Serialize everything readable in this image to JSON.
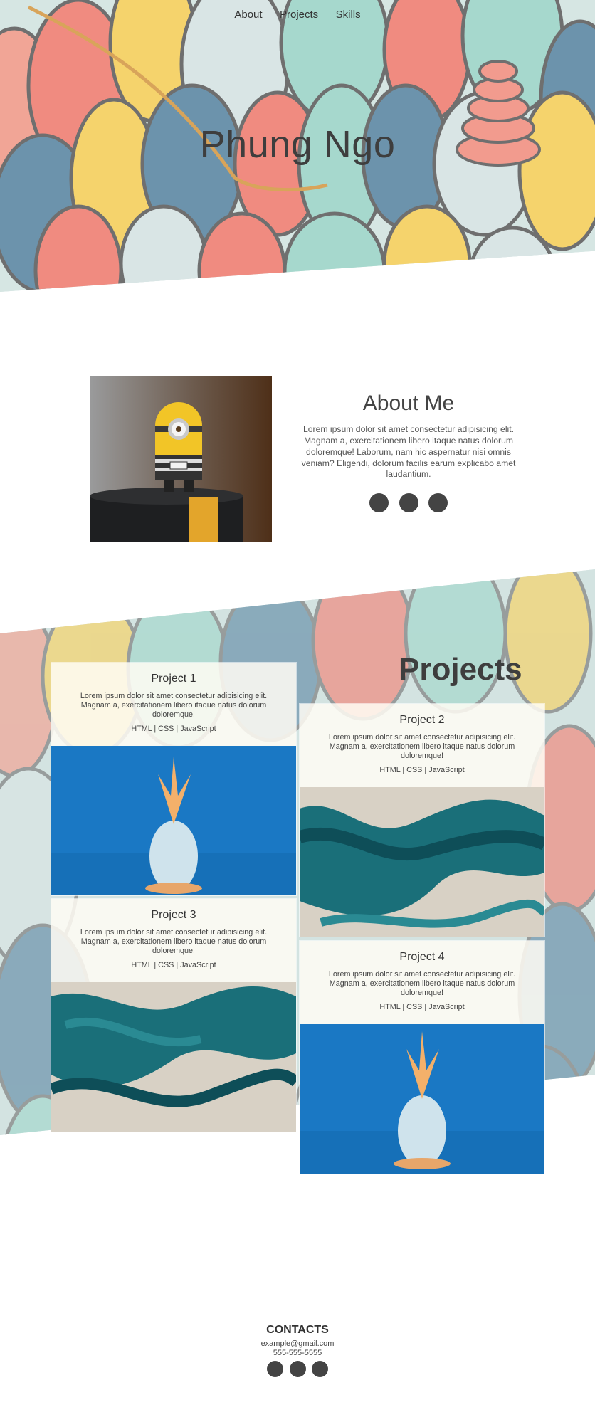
{
  "nav": {
    "items": [
      {
        "label": "About"
      },
      {
        "label": "Projects"
      },
      {
        "label": "Skills"
      }
    ]
  },
  "hero": {
    "title": "Phung Ngo",
    "background_palette": [
      "#f0877c",
      "#f5d36c",
      "#a6d8cd",
      "#6c93ac",
      "#d7e4e4"
    ]
  },
  "about": {
    "heading": "About Me",
    "text": "Lorem ipsum dolor sit amet consectetur adipisicing elit. Magnam a, exercitationem libero itaque natus dolorum doloremque! Laborum, nam hic aspernatur nisi omnis veniam? Eligendi, dolorum facilis earum explicabo amet laudantium.",
    "photo": "minion-toy-photo",
    "social_dots": 3
  },
  "projects": {
    "heading": "Projects",
    "items": [
      {
        "title": "Project 1",
        "description": "Lorem ipsum dolor sit amet consectetur adipisicing elit. Magnam a, exercitationem libero itaque natus dolorum doloremque!",
        "tech": "HTML | CSS | JavaScript",
        "image": "pineapple-on-blue"
      },
      {
        "title": "Project 2",
        "description": "Lorem ipsum dolor sit amet consectetur adipisicing elit. Magnam a, exercitationem libero itaque natus dolorum doloremque!",
        "tech": "HTML | CSS | JavaScript",
        "image": "teal-marble-swirl"
      },
      {
        "title": "Project 3",
        "description": "Lorem ipsum dolor sit amet consectetur adipisicing elit. Magnam a, exercitationem libero itaque natus dolorum doloremque!",
        "tech": "HTML | CSS | JavaScript",
        "image": "teal-marble-swirl"
      },
      {
        "title": "Project 4",
        "description": "Lorem ipsum dolor sit amet consectetur adipisicing elit. Magnam a, exercitationem libero itaque natus dolorum doloremque!",
        "tech": "HTML | CSS | JavaScript",
        "image": "pineapple-on-blue"
      }
    ]
  },
  "contacts": {
    "heading": "CONTACTS",
    "email": "example@gmail.com",
    "phone": "555-555-5555",
    "social_dots": 3
  },
  "colors": {
    "text": "#444444",
    "dot": "#444444",
    "card_bg": "#fffdf5",
    "image_blue": "#1976c2",
    "marble_teal": "#1a6f79"
  }
}
